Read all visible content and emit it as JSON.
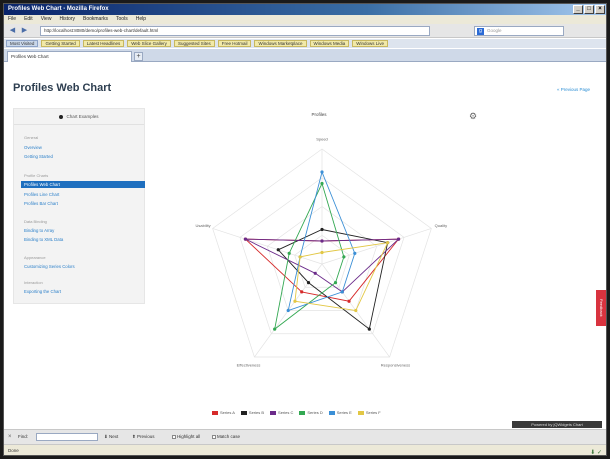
{
  "window": {
    "title": "Profiles Web Chart - Mozilla Firefox",
    "buttons": [
      "_",
      "□",
      "×"
    ]
  },
  "menu": [
    "File",
    "Edit",
    "View",
    "History",
    "Bookmarks",
    "Tools",
    "Help"
  ],
  "nav": {
    "back": "◀",
    "forward": "▶",
    "url": "http://localhost:8080/demo/profiles-web-chart/default.html",
    "search_placeholder": "Google"
  },
  "bookmarks": [
    "Most Visited",
    "Getting Started",
    "Latest Headlines",
    "Web Slice Gallery",
    "Suggested Sites",
    "Free Hotmail",
    "Windows Marketplace",
    "Windows Media",
    "Windows Live"
  ],
  "tab": {
    "label": "Profiles Web Chart",
    "new_tab": "+"
  },
  "page": {
    "title": "Profiles Web Chart",
    "top_link": "« Previous Page",
    "sidebar": {
      "top": "Chart Examples",
      "sections": [
        {
          "heading": "General",
          "items": [
            "Overview",
            "Getting Started"
          ]
        },
        {
          "heading": "Profile Charts",
          "items": [
            "Profiles Web Chart",
            "Profiles Line Chart",
            "Profiles Bar Chart"
          ]
        },
        {
          "heading": "Data Binding",
          "items": [
            "Binding to Array",
            "Binding to XML Data"
          ]
        },
        {
          "heading": "Appearance",
          "items": [
            "Customizing Series Colors"
          ]
        },
        {
          "heading": "Interaction",
          "items": [
            "Exporting the Chart"
          ]
        }
      ],
      "active_item": "Profiles Web Chart"
    },
    "chart_title": "Profiles",
    "feedback": "Feedback",
    "dark_button": "Powered by jQWidgets Chart"
  },
  "chart_data": {
    "type": "radar",
    "title": "Profiles",
    "categories": [
      "Speed",
      "Quality",
      "Responsiveness",
      "Effectiveness",
      "Usability"
    ],
    "max": 10,
    "series": [
      {
        "name": "Series A",
        "color": "#d62a2a",
        "values": [
          2,
          7,
          4,
          3,
          7
        ]
      },
      {
        "name": "Series B",
        "color": "#222222",
        "values": [
          3,
          6,
          7,
          2,
          4
        ]
      },
      {
        "name": "Series C",
        "color": "#6b2b8a",
        "values": [
          2,
          7,
          3,
          1,
          7
        ]
      },
      {
        "name": "Series D",
        "color": "#33a852",
        "values": [
          7,
          2,
          2,
          7,
          3
        ]
      },
      {
        "name": "Series E",
        "color": "#3b8fd6",
        "values": [
          8,
          3,
          3,
          5,
          2
        ]
      },
      {
        "name": "Series F",
        "color": "#e2c744",
        "values": [
          1,
          6,
          5,
          4,
          2
        ]
      }
    ]
  },
  "findbar": {
    "close": "×",
    "label": "Find:",
    "next": "⬇ Next",
    "previous": "⬆ Previous",
    "highlight": "Highlight all",
    "match_case": "Match case"
  },
  "status": {
    "text": "Done",
    "icons": "⬇ ✓"
  }
}
